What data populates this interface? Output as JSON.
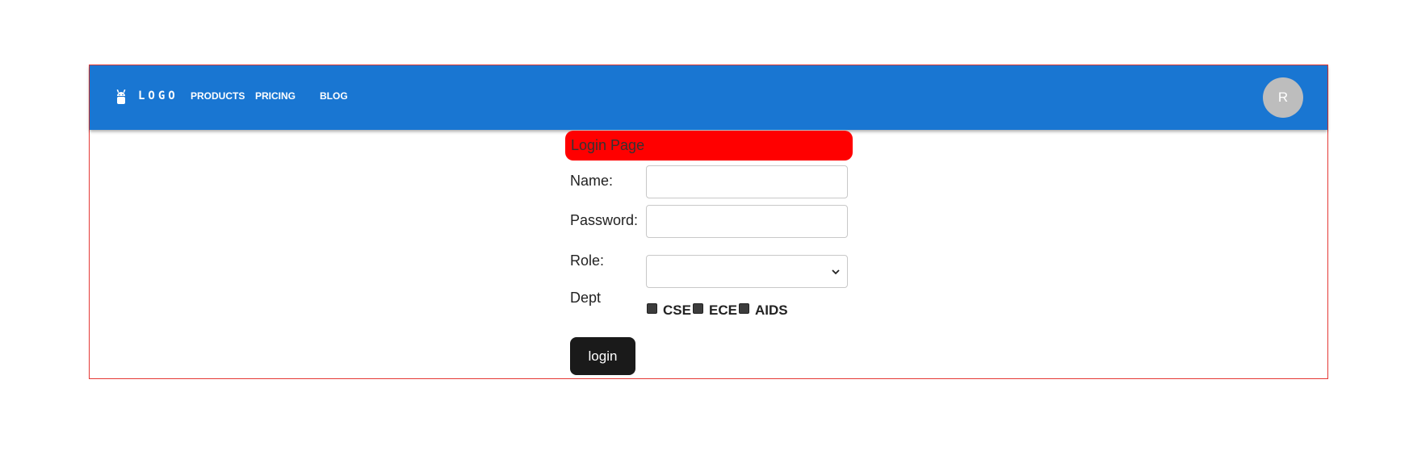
{
  "header": {
    "logo_text": "LOGO",
    "logo_icon": "android-icon",
    "nav": [
      "PRODUCTS",
      "PRICING",
      "BLOG"
    ],
    "avatar_initial": "R",
    "color": "#1976d2"
  },
  "form": {
    "title": "Login Page",
    "title_bg": "#ff0000",
    "name_label": "Name:",
    "name_value": "",
    "password_label": "Password:",
    "password_value": "",
    "role_label": "Role:",
    "role_value": "",
    "dept_label": "Dept",
    "dept_options": [
      "CSE",
      "ECE",
      "AIDS"
    ],
    "submit_label": "login"
  }
}
